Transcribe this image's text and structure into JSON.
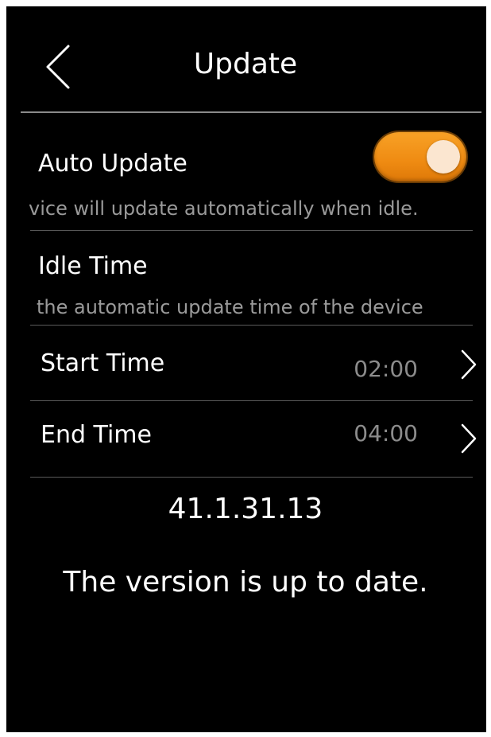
{
  "header": {
    "title": "Update"
  },
  "auto_update": {
    "label": "Auto Update",
    "description": "vice will update automatically when idle.",
    "enabled": true,
    "accent_color": "#F39416"
  },
  "idle_time": {
    "label": "Idle Time",
    "description": "the automatic update time of the device"
  },
  "start_time": {
    "label": "Start Time",
    "value": "02:00"
  },
  "end_time": {
    "label": "End Time",
    "value": "04:00"
  },
  "version": {
    "number": "41.1.31.13",
    "status": "The version is up to date."
  },
  "icons": {
    "back": "chevron-left-icon",
    "row_arrow": "chevron-right-icon"
  }
}
